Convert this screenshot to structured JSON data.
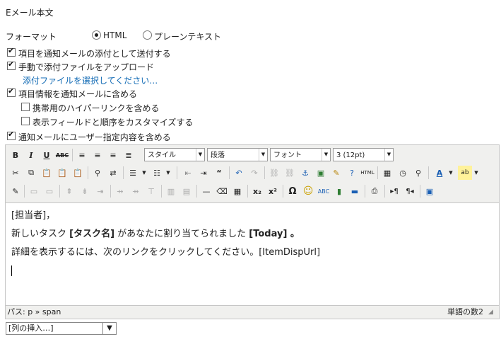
{
  "section_title": "Eメール本文",
  "format": {
    "label": "フォーマット",
    "options": [
      {
        "label": "HTML",
        "selected": true
      },
      {
        "label": "プレーンテキスト",
        "selected": false
      }
    ]
  },
  "checkboxes": [
    {
      "label": "項目を通知メールの添付として送付する",
      "checked": true
    },
    {
      "label": "手動で添付ファイルをアップロード",
      "checked": true
    },
    {
      "label": "項目情報を通知メールに含める",
      "checked": true
    },
    {
      "label": "携帯用のハイパーリンクを含める",
      "checked": false
    },
    {
      "label": "表示フィールドと順序をカスタマイズする",
      "checked": false
    },
    {
      "label": "通知メールにユーザー指定内容を含める",
      "checked": true
    }
  ],
  "attach_link": "添付ファイルを選択してください…",
  "toolbar": {
    "style_select": "スタイル",
    "paragraph_select": "段落",
    "font_select": "フォント",
    "size_select": "3 (12pt)"
  },
  "editor_content": {
    "line1": "[担当者]，",
    "line2_a": "新しいタスク ",
    "line2_b": "[タスク名]",
    "line2_c": " があなたに割り当てられました ",
    "line2_d": "[Today]",
    "line2_e": " 。",
    "line3": "詳細を表示するには、次のリンクをクリックしてください。[ItemDispUrl]"
  },
  "statusbar": {
    "path": "パス: p » span",
    "word_count": "単語の数2"
  },
  "insert_column": "[列の挿入…]",
  "colors": {
    "link": "#0f69b4",
    "toolbar_bg": "#f0f0ee"
  }
}
